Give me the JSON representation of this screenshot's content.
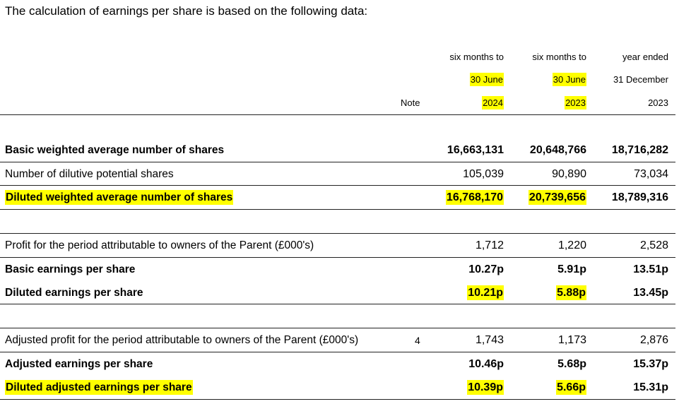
{
  "intro": "The calculation of earnings per share is based on the following data:",
  "headers": {
    "col1": {
      "line1": "six months to",
      "line2": "30 June",
      "line3": "2024"
    },
    "col2": {
      "line1": "six months to",
      "line2": "30 June",
      "line3": "2023"
    },
    "col3": {
      "line1": "year ended",
      "line2": "31 December",
      "line3": "2023"
    },
    "note": "Note"
  },
  "rows": [
    {
      "label": "Basic weighted average number of shares",
      "c1": "16,663,131",
      "c2": "20,648,766",
      "c3": "18,716,282"
    },
    {
      "label": "Number of dilutive potential shares",
      "c1": "105,039",
      "c2": "90,890",
      "c3": "73,034"
    },
    {
      "label": "Diluted weighted average number of shares",
      "c1": "16,768,170",
      "c2": "20,739,656",
      "c3": "18,789,316"
    },
    {
      "label": "Profit for the period attributable to owners of the Parent (£000's)",
      "c1": "1,712",
      "c2": "1,220",
      "c3": "2,528"
    },
    {
      "label": "Basic earnings per share",
      "c1": "10.27p",
      "c2": "5.91p",
      "c3": "13.51p"
    },
    {
      "label": "Diluted earnings per share",
      "c1": "10.21p",
      "c2": "5.88p",
      "c3": "13.45p"
    },
    {
      "label": "Adjusted profit for the period attributable to owners of the Parent (£000's)",
      "note": "4",
      "c1": "1,743",
      "c2": "1,173",
      "c3": "2,876"
    },
    {
      "label": "Adjusted earnings per share",
      "c1": "10.46p",
      "c2": "5.68p",
      "c3": "15.37p"
    },
    {
      "label": "Diluted adjusted earnings per share",
      "c1": "10.39p",
      "c2": "5.66p",
      "c3": "15.31p"
    }
  ],
  "highlight_color": "#ffff00"
}
